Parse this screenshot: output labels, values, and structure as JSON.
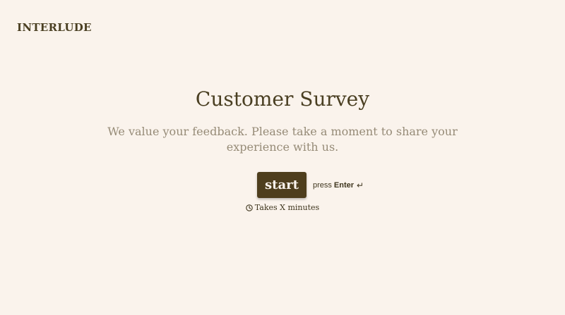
{
  "header": {
    "brand": "INTERLUDE"
  },
  "survey": {
    "title": "Customer Survey",
    "description": "We value your feedback. Please take a moment to share your experience with us.",
    "start_label": "start",
    "hint_prefix": "press",
    "hint_key": "Enter",
    "duration_text": "Takes X minutes"
  },
  "icons": {
    "enter": "enter-return-icon",
    "duration": "clock-icon"
  },
  "colors": {
    "background": "#faf3ec",
    "primary_text": "#4a3f22",
    "muted_text": "#968b77",
    "button_bg": "#4e3e1d"
  }
}
